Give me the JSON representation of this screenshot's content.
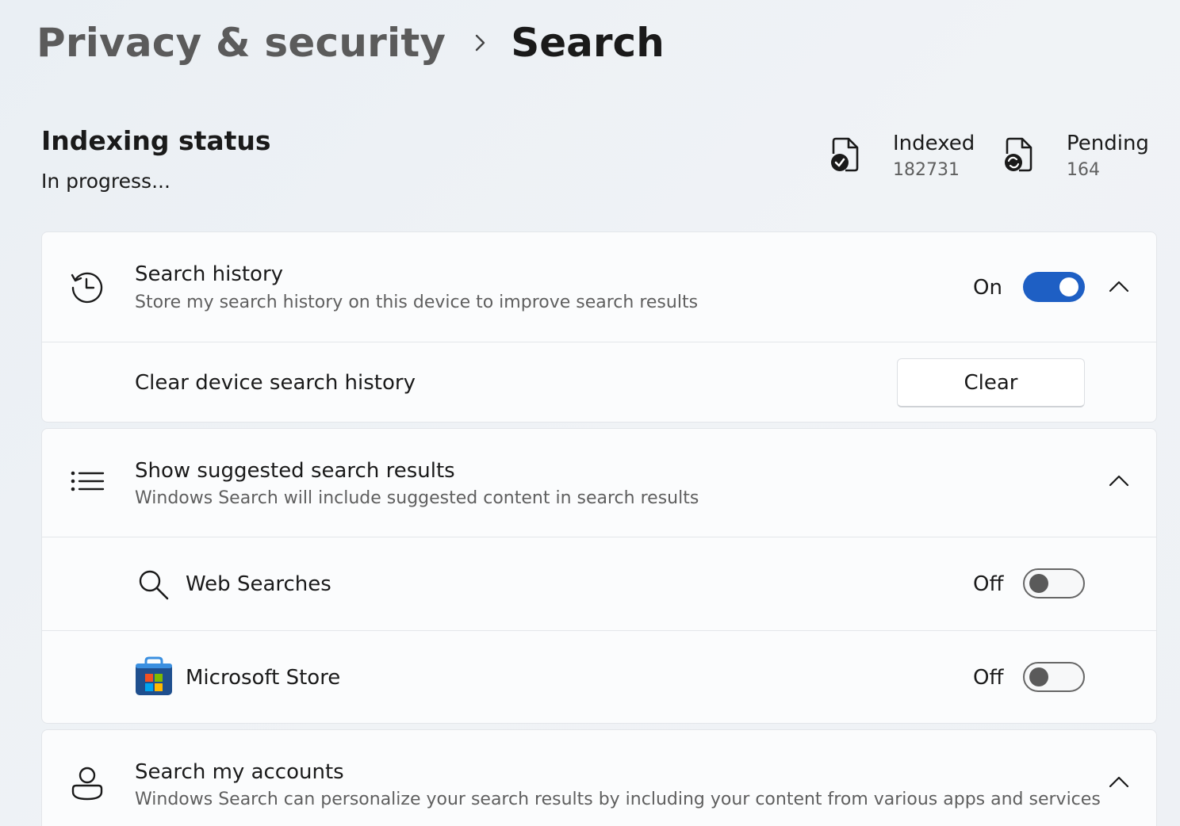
{
  "breadcrumb": {
    "parent": "Privacy & security",
    "current": "Search"
  },
  "indexing": {
    "title": "Indexing status",
    "status": "In progress...",
    "indexed_label": "Indexed",
    "indexed_value": "182731",
    "pending_label": "Pending",
    "pending_value": "164"
  },
  "search_history": {
    "title": "Search history",
    "description": "Store my search history on this device to improve search results",
    "toggle_state": "On",
    "clear_label": "Clear device search history",
    "clear_button": "Clear"
  },
  "suggested": {
    "title": "Show suggested search results",
    "description": "Windows Search will include suggested content in search results",
    "items": [
      {
        "label": "Web Searches",
        "state": "Off",
        "icon": "search-icon"
      },
      {
        "label": "Microsoft Store",
        "state": "Off",
        "icon": "microsoft-store-icon"
      }
    ]
  },
  "accounts": {
    "title": "Search my accounts",
    "description": "Windows Search can personalize your search results by including your content from various apps and services"
  },
  "colors": {
    "accent": "#1e5fc4",
    "card_background": "#fbfcfd"
  }
}
